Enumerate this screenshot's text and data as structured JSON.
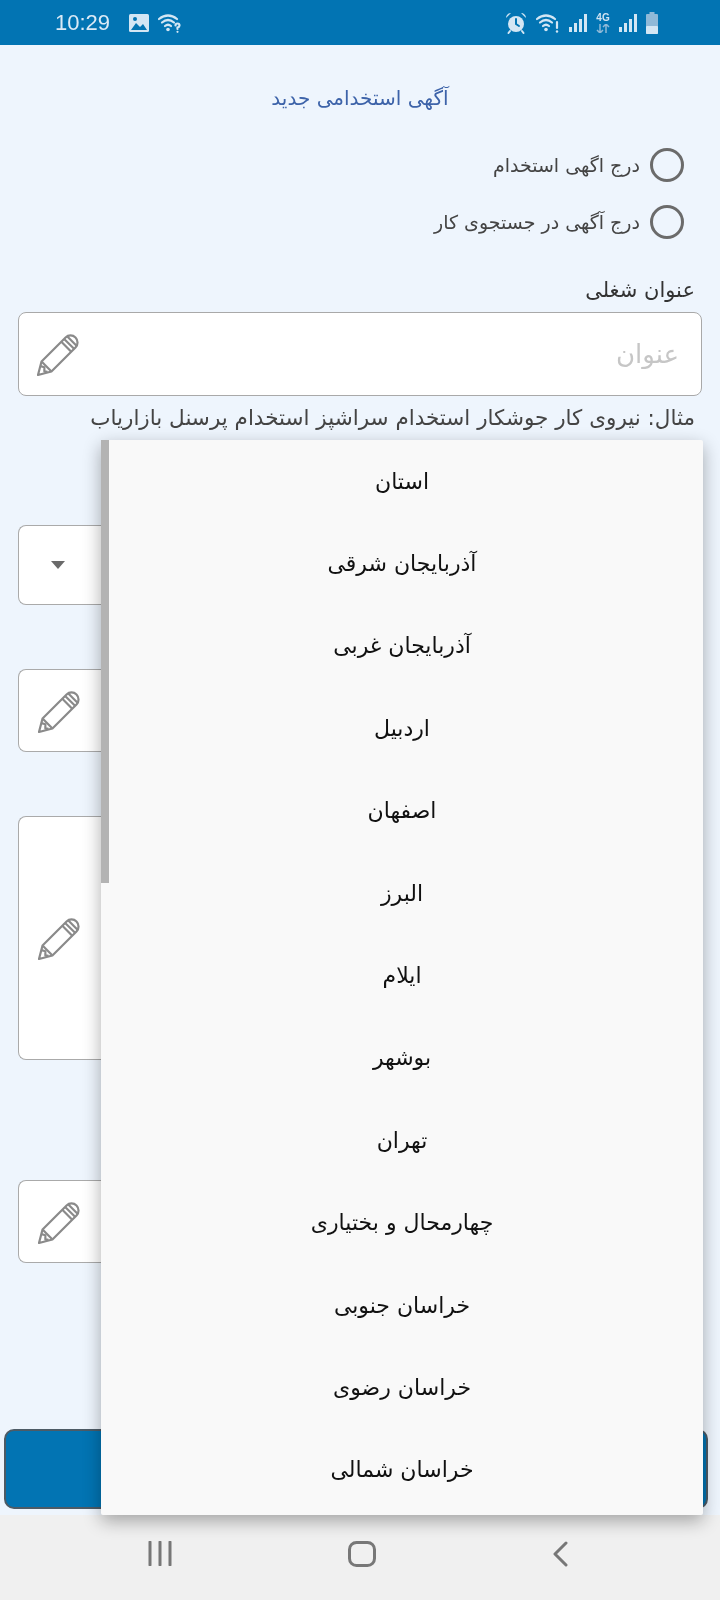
{
  "status_bar": {
    "time": "10:29",
    "network_type": "4G"
  },
  "form": {
    "title": "آگهی استخدامی جدید",
    "ad_type_options": [
      {
        "label": "درج اگهی استخدام",
        "selected": false
      },
      {
        "label": "درج آگهی در جستجوی کار",
        "selected": false
      }
    ],
    "job_title": {
      "label": "عنوان شغلی",
      "placeholder": "عنوان",
      "hint": "مثال: نیروی کار جوشکار استخدام سراشپز استخدام پرسنل بازاریاب"
    },
    "fields_behind_menu": [
      {
        "kind": "select"
      },
      {
        "kind": "text"
      },
      {
        "kind": "textarea"
      },
      {
        "kind": "text"
      },
      {
        "kind": "button"
      }
    ]
  },
  "province_menu": {
    "items": [
      {
        "label": "استان",
        "selected": false
      },
      {
        "label": "آذربایجان شرقی",
        "selected": false
      },
      {
        "label": "آذربایجان غربی",
        "selected": false
      },
      {
        "label": "اردبیل",
        "selected": false
      },
      {
        "label": "اصفهان",
        "selected": false
      },
      {
        "label": "البرز",
        "selected": false
      },
      {
        "label": "ایلام",
        "selected": false
      },
      {
        "label": "بوشهر",
        "selected": false
      },
      {
        "label": "تهران",
        "selected": false
      },
      {
        "label": "چهارمحال و بختیاری",
        "selected": false
      },
      {
        "label": "خراسان جنوبی",
        "selected": false
      },
      {
        "label": "خراسان رضوی",
        "selected": false
      },
      {
        "label": "خراسان شمالی",
        "selected": false
      }
    ]
  }
}
